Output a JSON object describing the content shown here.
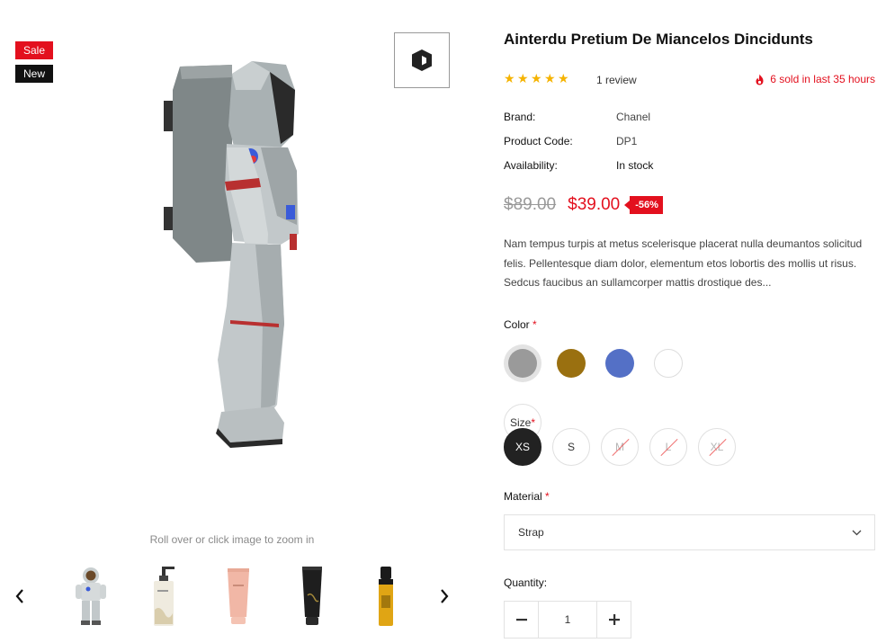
{
  "badges": {
    "sale": "Sale",
    "new": "New"
  },
  "gallery": {
    "zoom_hint": "Roll over or click image to zoom in",
    "thumbnails": [
      "astronaut-figure",
      "lotion-pump-bottle",
      "pink-cream-tube",
      "black-cream-tube",
      "gold-spray-bottle"
    ]
  },
  "product": {
    "title": "Ainterdu Pretium De Miancelos Dincidunts",
    "rating": 5,
    "reviews": "1 review",
    "sold": "6 sold in last 35 hours",
    "meta": [
      {
        "key": "Brand:",
        "value": "Chanel"
      },
      {
        "key": "Product Code:",
        "value": "DP1"
      },
      {
        "key": "Availability:",
        "value": "In stock"
      }
    ],
    "old_price": "$89.00",
    "new_price": "$39.00",
    "discount": "-56%",
    "description": "Nam tempus turpis at metus scelerisque placerat nulla deumantos solicitud felis. Pellentesque diam dolor, elementum etos lobortis des mollis ut risus. Sedcus faucibus an sullamcorper mattis drostique des...",
    "options": {
      "color_label": "Color",
      "colors": [
        "#9a9a9a",
        "#9a7010",
        "#5470c6",
        "#ffffff"
      ],
      "size_label": "Size",
      "sizes": [
        {
          "label": "XS",
          "state": "selected"
        },
        {
          "label": "S",
          "state": "available"
        },
        {
          "label": "M",
          "state": "unavailable"
        },
        {
          "label": "L",
          "state": "unavailable"
        },
        {
          "label": "XL",
          "state": "unavailable"
        }
      ],
      "material_label": "Material",
      "material_value": "Strap",
      "required_mark": "*",
      "quantity_label": "Quantity:",
      "quantity": "1"
    }
  },
  "colors": {
    "accent": "#e3101e",
    "star": "#f5b301",
    "dark": "#222222"
  }
}
